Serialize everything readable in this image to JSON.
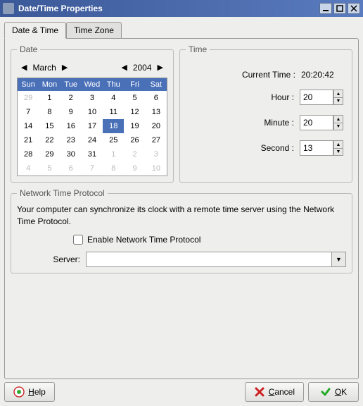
{
  "window": {
    "title": "Date/Time Properties"
  },
  "tabs": {
    "date_time": "Date & Time",
    "time_zone": "Time Zone"
  },
  "date": {
    "legend": "Date",
    "month": "March",
    "year": "2004",
    "days_short": [
      "Sun",
      "Mon",
      "Tue",
      "Wed",
      "Thu",
      "Fri",
      "Sat"
    ],
    "weeks": [
      [
        {
          "d": "29",
          "o": true
        },
        {
          "d": "1"
        },
        {
          "d": "2"
        },
        {
          "d": "3"
        },
        {
          "d": "4"
        },
        {
          "d": "5"
        },
        {
          "d": "6"
        }
      ],
      [
        {
          "d": "7"
        },
        {
          "d": "8"
        },
        {
          "d": "9"
        },
        {
          "d": "10"
        },
        {
          "d": "11"
        },
        {
          "d": "12"
        },
        {
          "d": "13"
        }
      ],
      [
        {
          "d": "14"
        },
        {
          "d": "15"
        },
        {
          "d": "16"
        },
        {
          "d": "17"
        },
        {
          "d": "18",
          "s": true
        },
        {
          "d": "19"
        },
        {
          "d": "20"
        }
      ],
      [
        {
          "d": "21"
        },
        {
          "d": "22"
        },
        {
          "d": "23"
        },
        {
          "d": "24"
        },
        {
          "d": "25"
        },
        {
          "d": "26"
        },
        {
          "d": "27"
        }
      ],
      [
        {
          "d": "28"
        },
        {
          "d": "29"
        },
        {
          "d": "30"
        },
        {
          "d": "31"
        },
        {
          "d": "1",
          "o": true
        },
        {
          "d": "2",
          "o": true
        },
        {
          "d": "3",
          "o": true
        }
      ],
      [
        {
          "d": "4",
          "o": true
        },
        {
          "d": "5",
          "o": true
        },
        {
          "d": "6",
          "o": true
        },
        {
          "d": "7",
          "o": true
        },
        {
          "d": "8",
          "o": true
        },
        {
          "d": "9",
          "o": true
        },
        {
          "d": "10",
          "o": true
        }
      ]
    ]
  },
  "time": {
    "legend": "Time",
    "current_label": "Current Time :",
    "current_value": "20:20:42",
    "hour_label": "Hour :",
    "hour_value": "20",
    "minute_label": "Minute :",
    "minute_value": "20",
    "second_label": "Second :",
    "second_value": "13"
  },
  "ntp": {
    "legend": "Network Time Protocol",
    "description": "Your computer can synchronize its clock with a remote time server using the Network Time Protocol.",
    "enable_label": "Enable Network Time Protocol",
    "server_label": "Server:",
    "server_value": ""
  },
  "buttons": {
    "help": "Help",
    "cancel": "Cancel",
    "ok": "OK"
  }
}
